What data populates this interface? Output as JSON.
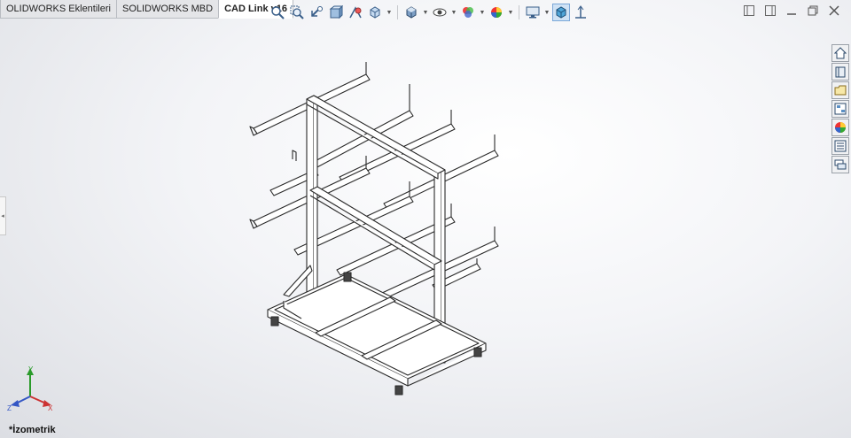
{
  "tabs": [
    {
      "label": "OLIDWORKS Eklentileri",
      "active": false
    },
    {
      "label": "SOLIDWORKS MBD",
      "active": false
    },
    {
      "label": "CAD Link v16",
      "active": true
    }
  ],
  "view": {
    "name": "*İzometrik",
    "triad": {
      "x": "X",
      "y": "Y",
      "z": "Z"
    }
  },
  "heads_up_toolbar": [
    "zoom-to-fit-icon",
    "zoom-to-area-icon",
    "previous-view-icon",
    "section-view-icon",
    "dynamic-annotation-views-icon",
    "view-orientation-icon",
    "display-style-icon",
    "hide-show-items-icon",
    "edit-appearance-icon",
    "apply-scene-icon",
    "view-settings-icon",
    "display-pane-icon",
    "triad-toggle-icon"
  ],
  "task_pane": [
    "solidworks-resources-icon",
    "design-library-icon",
    "file-explorer-icon",
    "view-palette-icon",
    "appearances-scenes-icon",
    "custom-properties-icon",
    "forum-icon"
  ],
  "colors": {
    "accent": "#2b6cb0",
    "model_line": "#2a2a2a",
    "viewport_bg": "#eef0f4"
  }
}
